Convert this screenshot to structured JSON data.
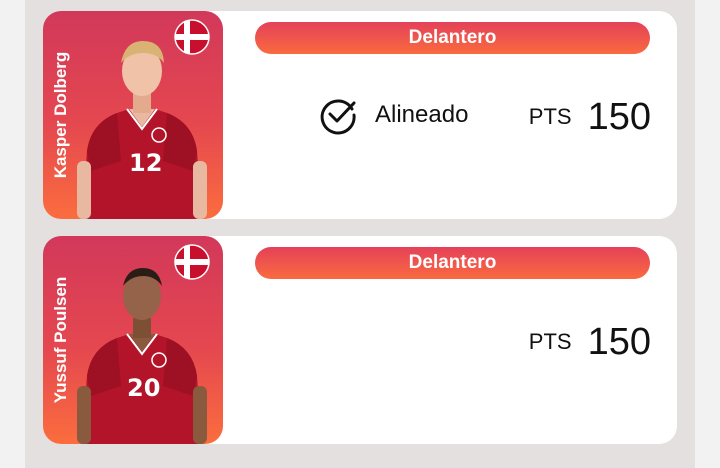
{
  "cards": [
    {
      "player": "Kasper Dolberg",
      "number": "12",
      "position": "Delantero",
      "status": "Alineado",
      "points_label": "PTS",
      "points": "150"
    },
    {
      "player": "Yussuf Poulsen",
      "number": "20",
      "position": "Delantero",
      "points_label": "PTS",
      "points": "150"
    }
  ],
  "colors": {
    "accent_top": "#d2385a",
    "accent_bottom": "#fb6d3e",
    "flag_red": "#c8102e"
  },
  "icons": {
    "flag": "denmark-flag-icon",
    "status": "check-circle-icon"
  }
}
